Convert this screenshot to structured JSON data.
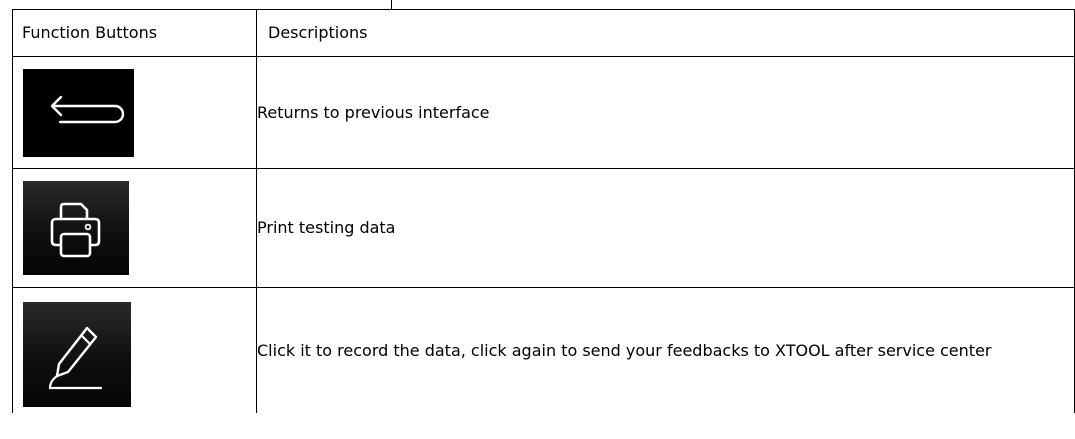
{
  "table": {
    "header": {
      "col1": "Function Buttons",
      "col2": "Descriptions"
    },
    "rows": [
      {
        "icon": "back-arrow-icon",
        "description": "Returns to previous interface"
      },
      {
        "icon": "printer-icon",
        "description": "Print testing data"
      },
      {
        "icon": "pen-icon",
        "description": "Click it to record the data, click again to send your feedbacks to XTOOL after service center"
      }
    ]
  },
  "colors": {
    "border": "#000000",
    "icon_background": "#000000",
    "icon_stroke": "#ffffff"
  }
}
